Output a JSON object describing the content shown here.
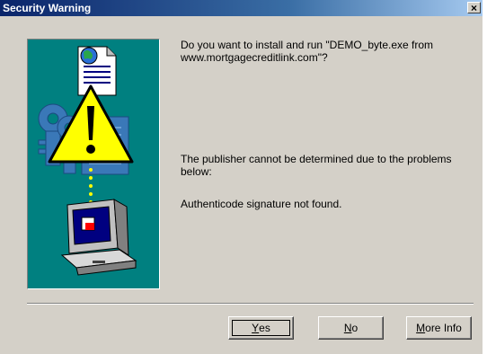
{
  "window": {
    "title": "Security Warning",
    "close_glyph": "×"
  },
  "message": {
    "question": "Do you want to install and run \"DEMO_byte.exe from www.mortgagecreditlink.com\"?",
    "publisher": "The publisher cannot be determined due to the problems below:",
    "authenticode": "Authenticode signature not found."
  },
  "buttons": {
    "yes": {
      "mnemonic": "Y",
      "rest": "es"
    },
    "no": {
      "mnemonic": "N",
      "rest": "o"
    },
    "more_info": {
      "mnemonic": "M",
      "rest": "ore Info"
    }
  },
  "colors": {
    "titlebar_start": "#0a246a",
    "titlebar_end": "#a6caf0",
    "dialog_bg": "#d4d0c8",
    "illustration_bg": "#008080",
    "warning_yellow": "#ffff00"
  },
  "icons": [
    "warning-icon",
    "document-icon",
    "globe-icon",
    "keys-icon",
    "certificate-icon",
    "computer-icon"
  ]
}
